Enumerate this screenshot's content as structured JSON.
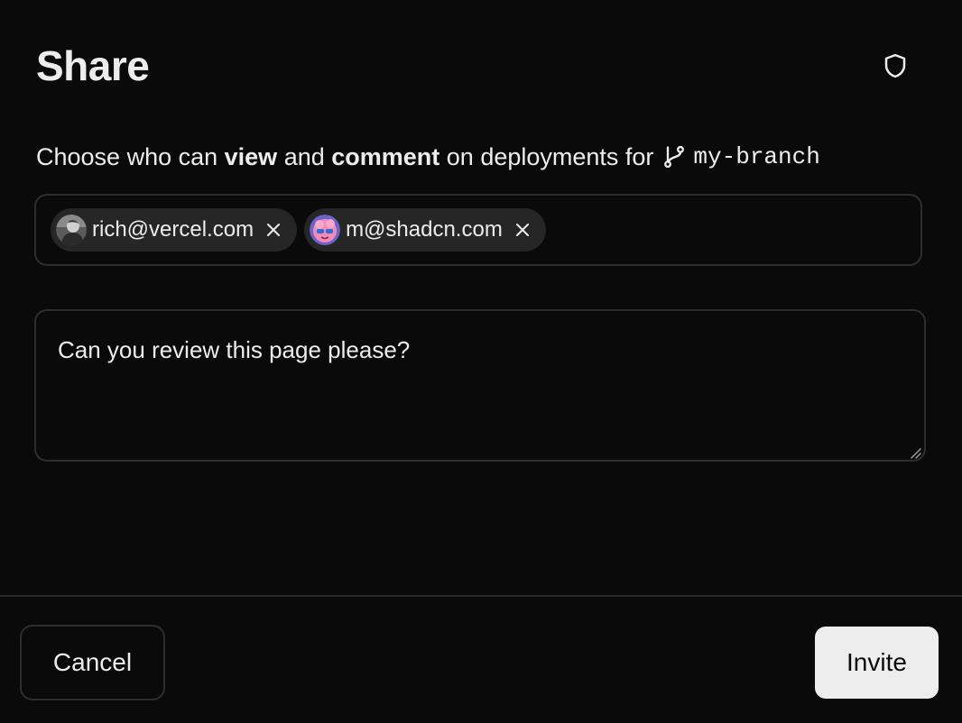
{
  "dialog": {
    "title": "Share",
    "security_icon": "shield-icon",
    "description": {
      "prefix": "Choose who can ",
      "bold_1": "view",
      "middle": " and ",
      "bold_2": "comment",
      "suffix": " on deployments for",
      "branch_icon": "git-branch-icon",
      "branch_name": "my-branch"
    },
    "recipients": [
      {
        "email": "rich@vercel.com",
        "avatar": "avatar-photo-grayscale",
        "remove_icon": "close-icon"
      },
      {
        "email": "m@shadcn.com",
        "avatar": "avatar-pink-illustration",
        "remove_icon": "close-icon"
      }
    ],
    "message": {
      "value": "Can you review this page please?",
      "placeholder": ""
    },
    "footer": {
      "cancel_label": "Cancel",
      "invite_label": "Invite"
    }
  },
  "colors": {
    "background": "#0a0a0a",
    "text": "#ededed",
    "border": "#2e2e2e",
    "chip_bg": "#262626",
    "primary_button_bg": "#ededed",
    "primary_button_text": "#0a0a0a"
  }
}
